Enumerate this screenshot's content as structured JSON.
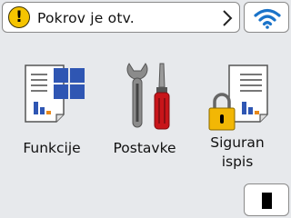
{
  "status": {
    "message": "Pokrov je otv.",
    "warning_glyph": "!",
    "warning_color": "#f5c400"
  },
  "header": {
    "wifi_icon": "wifi-icon",
    "wifi_color": "#1a73c9"
  },
  "tiles": [
    {
      "label": "Funkcije",
      "icon": "functions-icon"
    },
    {
      "label": "Postavke",
      "icon": "settings-icon"
    },
    {
      "label_line1": "Siguran",
      "label_line2": "ispis",
      "icon": "secure-print-icon"
    }
  ],
  "footer": {
    "toner_icon": "mono-toner-icon"
  }
}
